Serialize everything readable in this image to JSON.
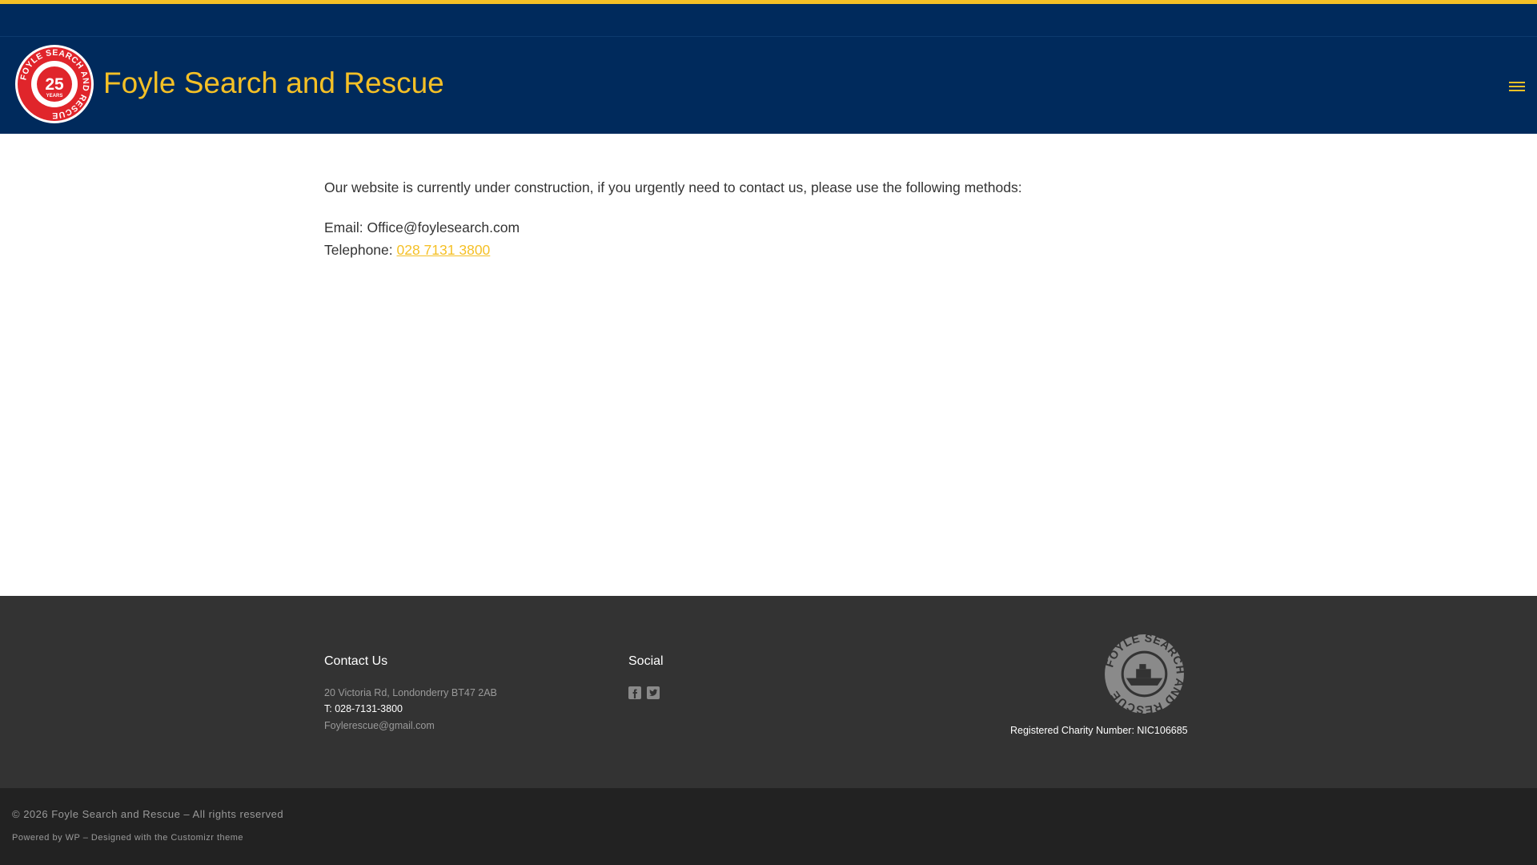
{
  "header": {
    "site_title": "Foyle Search and Rescue",
    "logo": {
      "ring_text": "FOYLE SEARCH AND RESCUE",
      "big_number": "25",
      "small_text": "YEARS"
    },
    "menu_icon": "hamburger-menu-icon"
  },
  "main": {
    "intro": "Our website is currently under construction, if you urgently need to contact us, please use the following methods:",
    "email_line": "Email: Office@foylesearch.com",
    "telephone_label": "Telephone: ",
    "telephone_link": "028 7131 3800"
  },
  "footer": {
    "contact": {
      "title": "Contact Us",
      "address": "20 Victoria Rd, Londonderry BT47 2AB",
      "phone": "T: 028-7131-3800",
      "email": "Foylerescue@gmail.com"
    },
    "social": {
      "title": "Social",
      "icons": [
        "facebook-icon",
        "twitter-icon"
      ]
    },
    "charity": {
      "badge_text": "FOYLE SEARCH AND RESCUE",
      "number": "Registered Charity Number: NIC106685"
    }
  },
  "colophon": {
    "copyright": "© 2026 Foyle Search and Rescue – All rights reserved",
    "credits": "Powered by WP – Designed with the Customizr theme"
  },
  "colors": {
    "accent": "#f5c026",
    "header_bg": "#002a5c",
    "footer_bg": "#333333",
    "colophon_bg": "#222222",
    "logo_red": "#e0252b"
  }
}
